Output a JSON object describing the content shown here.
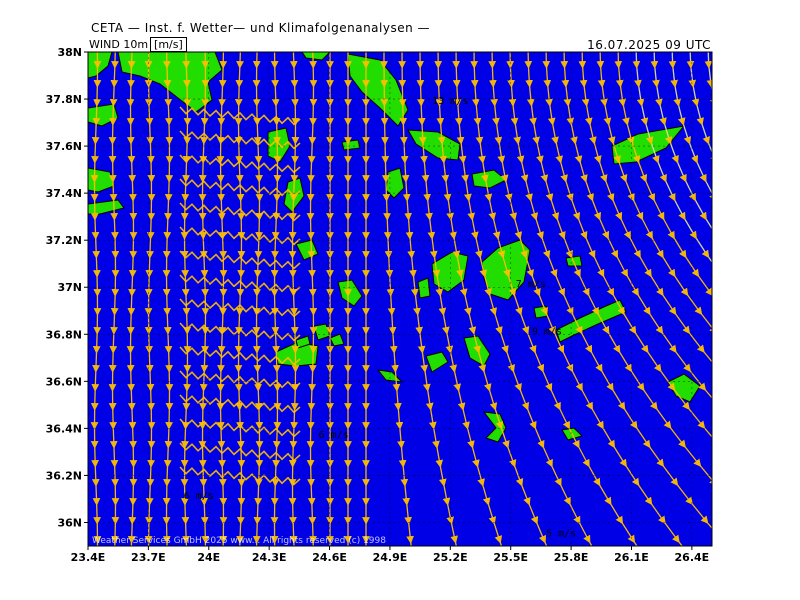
{
  "header": {
    "title": "CETA — Inst. f. Wetter— und Klimafolgenanalysen —",
    "variable": "WIND 10m",
    "unit": "[m/s]",
    "valid_time": "16.07.2025  09 UTC"
  },
  "credit": "Weather Services GmbH 2025 www... All rights reserved (c) 1998",
  "axes": {
    "x_ticks": [
      "23.4E",
      "23.7E",
      "24E",
      "24.3E",
      "24.6E",
      "24.9E",
      "25.2E",
      "25.5E",
      "25.8E",
      "26.1E",
      "26.4E"
    ],
    "y_ticks": [
      "38N",
      "37.8N",
      "37.6N",
      "37.4N",
      "37.2N",
      "37N",
      "36.8N",
      "36.6N",
      "36.4N",
      "36.2N",
      "36N"
    ],
    "lon_range": [
      23.4,
      26.5
    ],
    "lat_range": [
      35.9,
      38.0
    ]
  },
  "speed_labels": [
    {
      "text": "13 m/s",
      "lon": 25.2,
      "lat": 37.78
    },
    {
      "text": "7 m/s",
      "lon": 25.6,
      "lat": 37.0
    },
    {
      "text": "9 m/s",
      "lon": 25.68,
      "lat": 36.8
    },
    {
      "text": "6 m/s",
      "lon": 24.62,
      "lat": 36.36
    },
    {
      "text": "6 m/s",
      "lon": 23.95,
      "lat": 36.1
    },
    {
      "text": "5 m/s",
      "lon": 25.75,
      "lat": 35.94
    }
  ],
  "colors": {
    "sea": "#0000e6",
    "land": "#22dd00",
    "streamline": "#ffc000",
    "streamline_weak": "#dde0a0",
    "coast": "#000000"
  }
}
